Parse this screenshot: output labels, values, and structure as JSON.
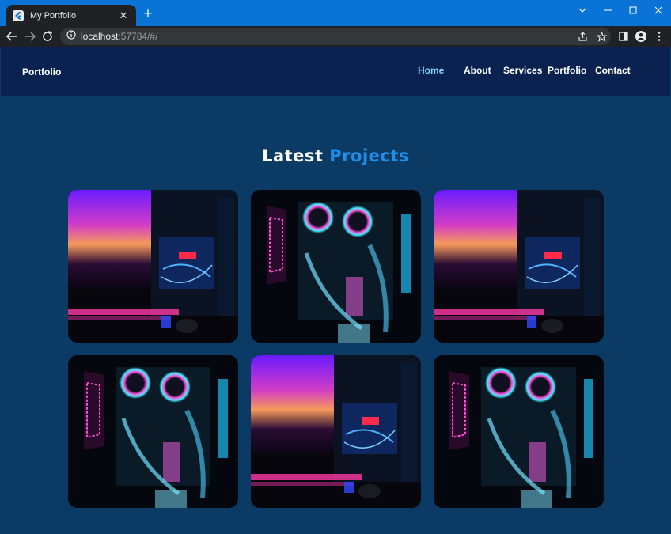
{
  "browser": {
    "tab_title": "My Portfolio",
    "url_host": "localhost",
    "url_rest": ":57784/#/"
  },
  "nav": {
    "brand": "Portfolio",
    "links": [
      "Home",
      "About",
      "Services",
      "Portfolio",
      "Contact"
    ],
    "active": "Home"
  },
  "section": {
    "title_part1": "Latest",
    "title_part2": "Projects"
  },
  "projects": [
    {
      "image": "pc-build-purple-glow"
    },
    {
      "image": "pc-build-cyan-fans"
    },
    {
      "image": "pc-build-purple-glow"
    },
    {
      "image": "pc-build-cyan-fans"
    },
    {
      "image": "pc-build-purple-glow"
    },
    {
      "image": "pc-build-cyan-fans"
    }
  ],
  "colors": {
    "nav_bg": "#0a2250",
    "page_bg": "#0b3a64",
    "active_link": "#7fd6ff",
    "accent_blue": "#1f8ee8"
  }
}
